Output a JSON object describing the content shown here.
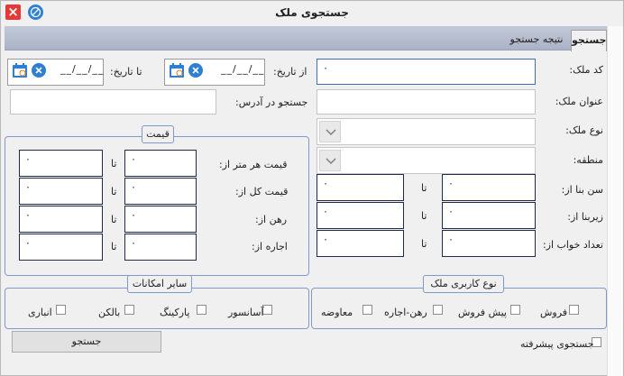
{
  "window": {
    "title": "جستجوی ملک",
    "close_glyph": "×"
  },
  "tabs": [
    {
      "label": "جستجو",
      "active": true
    },
    {
      "label": "نتیجه جستجو",
      "active": false
    }
  ],
  "fields": {
    "code": {
      "label": "کد ملک:",
      "value": "۰"
    },
    "title": {
      "label": "عنوان ملک:",
      "value": ""
    },
    "type": {
      "label": "نوع ملک:",
      "value": ""
    },
    "region": {
      "label": "منطقه:",
      "value": ""
    },
    "date_from_label": "از تاریخ:",
    "date_to_label": "تا تاریخ:",
    "date_from": "__/__/__",
    "date_to": "__/__/__",
    "address": {
      "label": "جستجو در آدرس:",
      "value": ""
    }
  },
  "ranges_left": {
    "to_label": "تا",
    "rows": [
      {
        "label": "سن بنا از:",
        "from": "۰",
        "to": "۰"
      },
      {
        "label": "زیربنا از:",
        "from": "۰",
        "to": "۰"
      },
      {
        "label": "تعداد خواب از:",
        "from": "۰",
        "to": "۰"
      }
    ]
  },
  "price": {
    "title": "قیمت",
    "to_label": "تا",
    "rows": [
      {
        "label": "قیمت هر متر از:",
        "from": "۰",
        "to": "۰"
      },
      {
        "label": "قیمت کل از:",
        "from": "۰",
        "to": "۰"
      },
      {
        "label": "رهن از:",
        "from": "۰",
        "to": "۰"
      },
      {
        "label": "اجاره از:",
        "from": "۰",
        "to": "۰"
      }
    ]
  },
  "usage": {
    "title": "نوع کاربری ملک",
    "options": [
      "فروش",
      "پیش فروش",
      "رهن-اجاره",
      "معاوضه"
    ]
  },
  "amenities": {
    "title": "سایر امکانات",
    "options": [
      "آسانسور",
      "پارکینگ",
      "بالکن",
      "انباری"
    ]
  },
  "advanced": {
    "label": "جستجوی پیشرفته",
    "checked": false
  },
  "search_button": "جستجو",
  "colors": {
    "close": "#e53935",
    "accent": "#2d7fd3",
    "group_border": "#7f99c9",
    "tabstrip": "#b6bdcf"
  }
}
